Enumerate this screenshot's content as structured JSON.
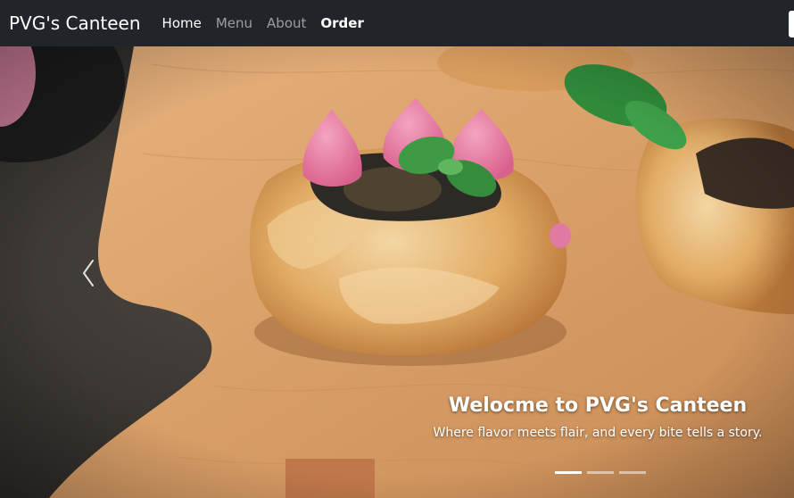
{
  "navbar": {
    "brand": "PVG's Canteen",
    "links": [
      {
        "label": "Home"
      },
      {
        "label": "Menu"
      },
      {
        "label": "About"
      },
      {
        "label": "Order"
      }
    ]
  },
  "carousel": {
    "caption_title": "Welocme to PVG's Canteen",
    "caption_text": "Where flavor meets flair, and every bite tells a story.",
    "slide_count": 3,
    "active_slide": 1,
    "image_subject": "pastries-with-pink-meringue-and-mint-on-wooden-board"
  },
  "icons": {
    "prev": "chevron-left-icon"
  },
  "colors": {
    "navbar_bg": "#212529",
    "caption_text": "#ffffff",
    "board": "#d9a06a"
  }
}
